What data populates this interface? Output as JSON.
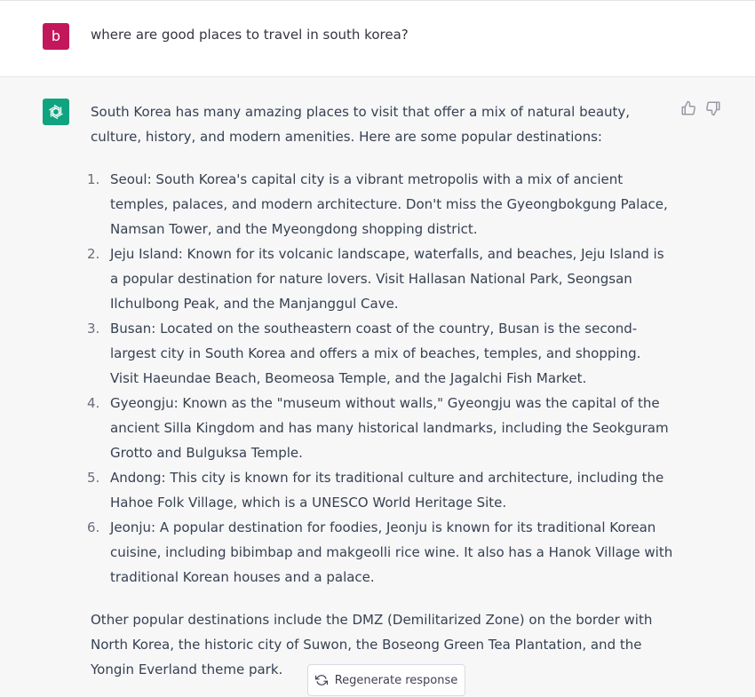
{
  "user_message": {
    "avatar_letter": "b",
    "text": "where are good places to travel in south korea?"
  },
  "assistant_message": {
    "intro": "South Korea has many amazing places to visit that offer a mix of natural beauty, culture, history, and modern amenities. Here are some popular destinations:",
    "destinations": [
      {
        "number": "1.",
        "text": "Seoul: South Korea's capital city is a vibrant metropolis with a mix of ancient temples, palaces, and modern architecture. Don't miss the Gyeongbokgung Palace, Namsan Tower, and the Myeongdong shopping district."
      },
      {
        "number": "2.",
        "text": "Jeju Island: Known for its volcanic landscape, waterfalls, and beaches, Jeju Island is a popular destination for nature lovers. Visit Hallasan National Park, Seongsan Ilchulbong Peak, and the Manjanggul Cave."
      },
      {
        "number": "3.",
        "text": "Busan: Located on the southeastern coast of the country, Busan is the second-largest city in South Korea and offers a mix of beaches, temples, and shopping. Visit Haeundae Beach, Beomeosa Temple, and the Jagalchi Fish Market."
      },
      {
        "number": "4.",
        "text": "Gyeongju: Known as the \"museum without walls,\" Gyeongju was the capital of the ancient Silla Kingdom and has many historical landmarks, including the Seokguram Grotto and Bulguksa Temple."
      },
      {
        "number": "5.",
        "text": "Andong: This city is known for its traditional culture and architecture, including the Hahoe Folk Village, which is a UNESCO World Heritage Site."
      },
      {
        "number": "6.",
        "text": "Jeonju: A popular destination for foodies, Jeonju is known for its traditional Korean cuisine, including bibimbap and makgeolli rice wine. It also has a Hanok Village with traditional Korean houses and a palace."
      }
    ],
    "outro": "Other popular destinations include the DMZ (Demilitarized Zone) on the border with North Korea, the historic city of Suwon, the Boseong Green Tea Plantation, and the Yongin Everland theme park."
  },
  "actions": {
    "regenerate_label": "Regenerate response"
  },
  "icons": {
    "assistant_avatar": "openai-logo-icon",
    "thumbs_up": "thumbs-up-icon",
    "thumbs_down": "thumbs-down-icon",
    "regenerate": "refresh-icon"
  },
  "colors": {
    "user_avatar_bg": "#c2185b",
    "assistant_avatar_bg": "#10a37f",
    "assistant_row_bg": "#f7f7f8"
  }
}
